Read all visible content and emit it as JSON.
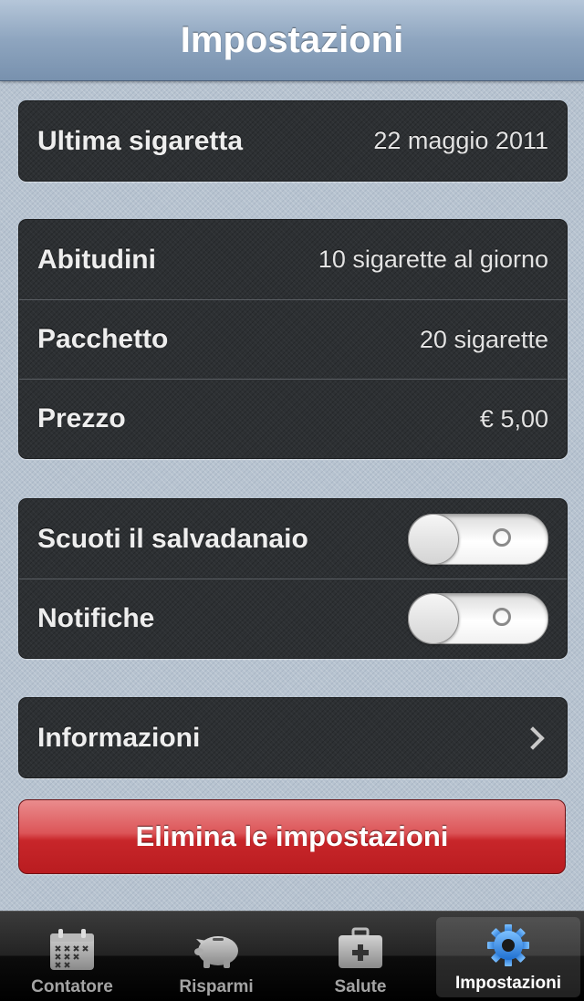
{
  "navbar": {
    "title": "Impostazioni"
  },
  "last_cigarette": {
    "label": "Ultima sigaretta",
    "value": "22 maggio 2011"
  },
  "habits": {
    "rows": [
      {
        "label": "Abitudini",
        "value": "10 sigarette al giorno"
      },
      {
        "label": "Pacchetto",
        "value": "20 sigarette"
      },
      {
        "label": "Prezzo",
        "value": "€ 5,00"
      }
    ]
  },
  "toggles": {
    "rows": [
      {
        "label": "Scuoti il salvadanaio",
        "on": false
      },
      {
        "label": "Notifiche",
        "on": false
      }
    ]
  },
  "info": {
    "label": "Informazioni"
  },
  "reset_button": {
    "label": "Elimina le impostazioni"
  },
  "tabbar": {
    "tabs": [
      {
        "label": "Contatore",
        "icon": "calendar-icon",
        "active": false
      },
      {
        "label": "Risparmi",
        "icon": "piggy-bank-icon",
        "active": false
      },
      {
        "label": "Salute",
        "icon": "medical-kit-icon",
        "active": false
      },
      {
        "label": "Impostazioni",
        "icon": "gear-icon",
        "active": true
      }
    ]
  },
  "colors": {
    "danger": "#c8262a",
    "active_tab_icon": "#3d8fe6"
  }
}
